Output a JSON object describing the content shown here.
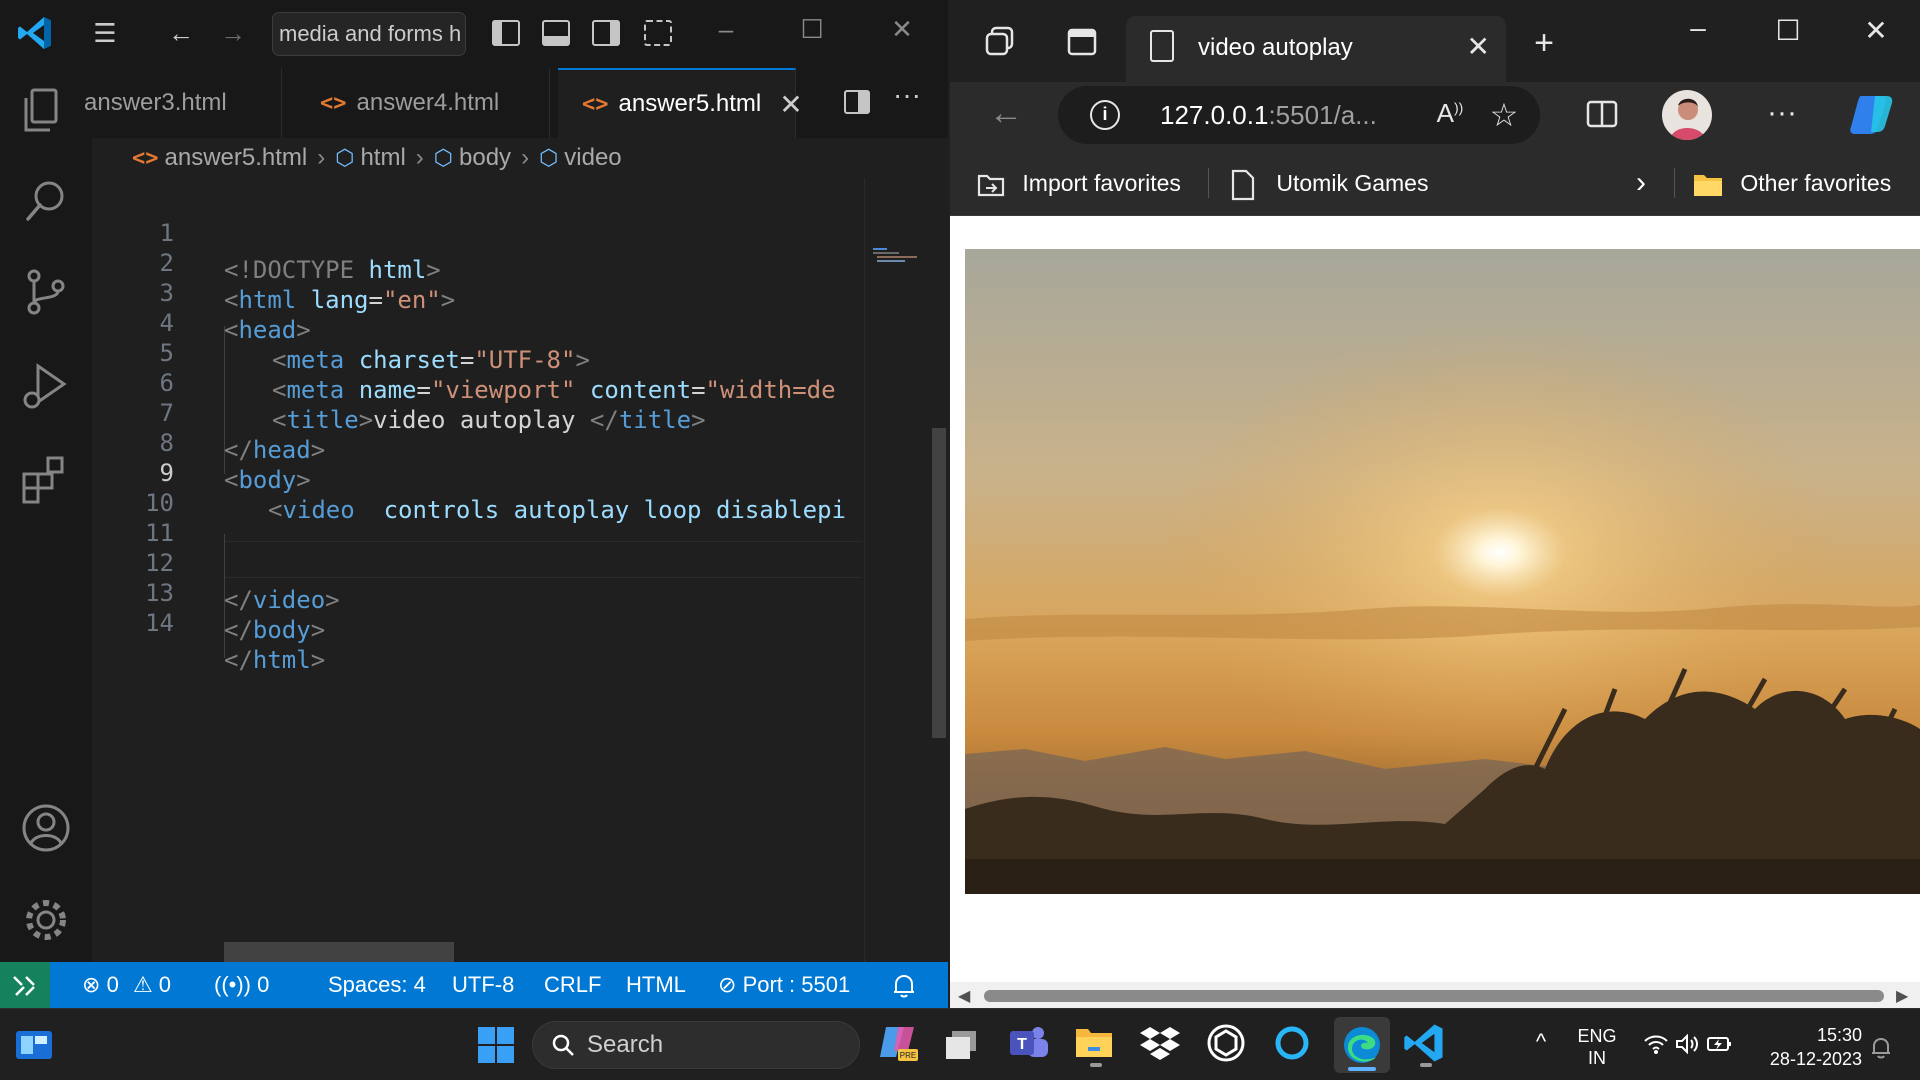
{
  "vscode": {
    "search_text": "media and forms h",
    "tabs": [
      {
        "label": "answer3.html",
        "active": false
      },
      {
        "label": "answer4.html",
        "active": false
      },
      {
        "label": "answer5.html",
        "active": true
      }
    ],
    "breadcrumb": [
      "answer5.html",
      "html",
      "body",
      "video"
    ],
    "code": [
      {
        "n": "1"
      },
      {
        "n": "2"
      },
      {
        "n": "3"
      },
      {
        "n": "4"
      },
      {
        "n": "5"
      },
      {
        "n": "6"
      },
      {
        "n": "7"
      },
      {
        "n": "8"
      },
      {
        "n": "9"
      },
      {
        "n": "10"
      },
      {
        "n": "11"
      },
      {
        "n": "12"
      },
      {
        "n": "13"
      },
      {
        "n": "14"
      }
    ],
    "code_tokens": {
      "doctype": "<!DOCTYPE",
      "html_kw": "html",
      "gt": ">",
      "lt": "<",
      "lt_slash": "</",
      "html": "html",
      "lang": "lang",
      "eq": "=",
      "en": "\"en\"",
      "head": "head",
      "meta": "meta",
      "charset": "charset",
      "utf8": "\"UTF-8\"",
      "name": "name",
      "viewport": "\"viewport\"",
      "content": "content",
      "width": "\"width=de",
      "title": "title",
      "title_text": "video autoplay ",
      "body": "body",
      "video": "video",
      "video_attrs": "controls autoplay loop disablepi"
    },
    "status": {
      "errors": "0",
      "warnings": "0",
      "ports": "0",
      "spaces": "Spaces: 4",
      "encoding": "UTF-8",
      "eol": "CRLF",
      "language": "HTML",
      "port": "Port : 5501"
    },
    "accent": "#0078d4",
    "remote_color": "#16825d"
  },
  "edge": {
    "tab_title": "video autoplay",
    "url_host": "127.0.0.1",
    "url_rest": ":5501/a...",
    "favorites": [
      "Import favorites",
      "Utomik Games"
    ],
    "other_favorites": "Other favorites"
  },
  "taskbar": {
    "search_label": "Search",
    "language": "ENG",
    "region": "IN",
    "time": "15:30",
    "date": "28-12-2023"
  }
}
